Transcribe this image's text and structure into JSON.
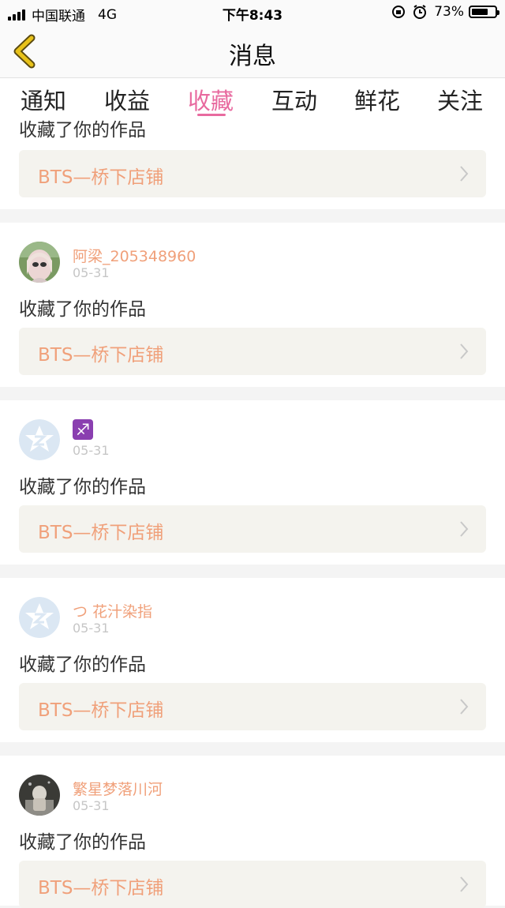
{
  "status_bar": {
    "carrier": "中国联通",
    "network": "4G",
    "time": "下午8:43",
    "battery_pct": "73%",
    "battery_level": 0.73
  },
  "nav": {
    "title": "消息"
  },
  "tabs": [
    {
      "label": "通知"
    },
    {
      "label": "收益"
    },
    {
      "label": "收藏"
    },
    {
      "label": "互动"
    },
    {
      "label": "鲜花"
    },
    {
      "label": "关注"
    }
  ],
  "active_tab": "收藏",
  "partial_item": {
    "action": "收藏了你的作品",
    "work": "BTS—桥下店铺"
  },
  "items": [
    {
      "user": "阿梁_205348960",
      "date": "05-31",
      "action": "收藏了你的作品",
      "work": "BTS—桥下店铺",
      "avatar": "photo"
    },
    {
      "user": "♐",
      "date": "05-31",
      "action": "收藏了你的作品",
      "work": "BTS—桥下店铺",
      "avatar": "default"
    },
    {
      "user": "つ 花汁染指",
      "date": "05-31",
      "action": "收藏了你的作品",
      "work": "BTS—桥下店铺",
      "avatar": "default"
    },
    {
      "user": "繁星梦落川河",
      "date": "05-31",
      "action": "收藏了你的作品",
      "work": "BTS—桥下店铺",
      "avatar": "photo"
    }
  ],
  "colors": {
    "accent": "#e86a9f",
    "username": "#f0a07a",
    "work_box_bg": "#f4f3ee",
    "back_arrow": "#e8c21a"
  }
}
